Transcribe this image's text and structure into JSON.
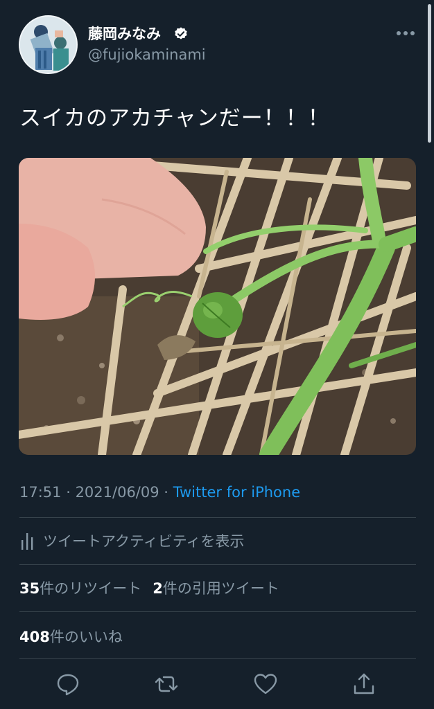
{
  "user": {
    "display_name": "藤岡みなみ",
    "handle": "@fujiokaminami",
    "verified": true
  },
  "tweet": {
    "text": "スイカのアカチャンだー！！！",
    "photo_icon": "watermelon-sprout-photo"
  },
  "meta": {
    "time": "17:51",
    "separator1": " · ",
    "date": "2021/06/09",
    "separator2": " · ",
    "source": "Twitter for iPhone"
  },
  "activity": {
    "label": "ツイートアクティビティを表示",
    "icon": "bar-chart-icon"
  },
  "stats": {
    "retweets_count": "35",
    "retweets_label": "件のリツイート",
    "quotes_count": "2",
    "quotes_label": "件の引用ツイート",
    "likes_count": "408",
    "likes_label": "件のいいね"
  },
  "actions": [
    "reply-icon",
    "retweet-icon",
    "like-icon",
    "share-icon"
  ],
  "colors": {
    "background": "#15202b",
    "text": "#ffffff",
    "secondary": "#8899a6",
    "accent": "#1d9bf0",
    "divider": "#38444d"
  }
}
